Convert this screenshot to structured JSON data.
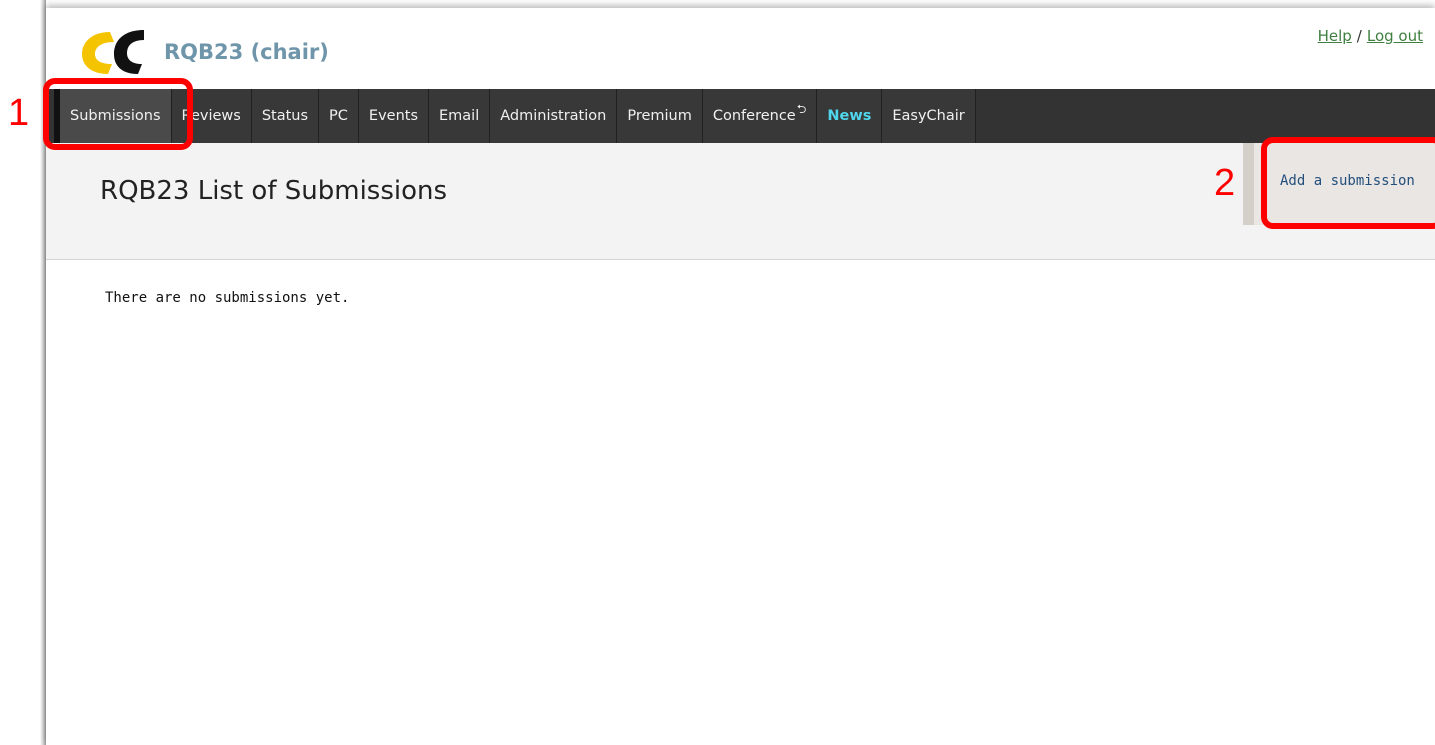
{
  "header": {
    "conference_title": "RQB23 (chair)",
    "help_link": "Help",
    "separator": "/",
    "logout_link": "Log out"
  },
  "menu": {
    "items": [
      {
        "label": "Submissions"
      },
      {
        "label": "Reviews"
      },
      {
        "label": "Status"
      },
      {
        "label": "PC"
      },
      {
        "label": "Events"
      },
      {
        "label": "Email"
      },
      {
        "label": "Administration"
      },
      {
        "label": "Premium"
      },
      {
        "label": "Conference"
      },
      {
        "label": "News"
      },
      {
        "label": "EasyChair"
      }
    ],
    "active": "Submissions"
  },
  "page": {
    "title": "RQB23 List of Submissions",
    "add_submission_link": "Add a submission",
    "empty_message": "There are no submissions yet."
  },
  "annotations": {
    "label_1": "1",
    "label_2": "2"
  },
  "icons": {
    "logo": "easychair-logo",
    "conference_suffix": "refresh-arrow-icon"
  },
  "colors": {
    "menu_bg": "#333333",
    "news": "#4fd5ec",
    "title": "#6f95aa",
    "link_green": "#3f7f3f",
    "link_blue": "#244f7d",
    "annotation": "#ff0000"
  }
}
